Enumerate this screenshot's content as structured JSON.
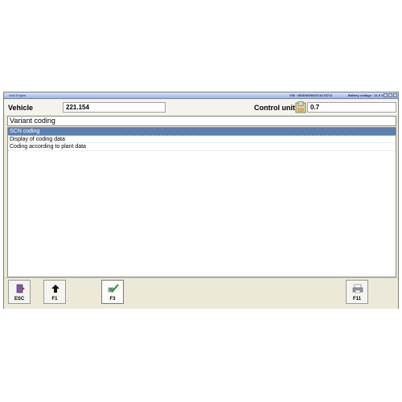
{
  "titlebar": {
    "app_title": "Vedi Engine",
    "vin_text": "VIN : WDDNG56X37A178711",
    "battery_text": "Battery voltage : 11.9 V"
  },
  "header": {
    "vehicle_label": "Vehicle",
    "vehicle_value": "221.154",
    "control_unit_label": "Control unit",
    "control_unit_value": "0.7"
  },
  "section": {
    "title": "Variant coding"
  },
  "list": {
    "items": [
      {
        "label": "SCN coding",
        "selected": true
      },
      {
        "label": "Display of coding data",
        "selected": false
      },
      {
        "label": "Coding according to plant data",
        "selected": false
      }
    ]
  },
  "toolbar": {
    "keys": [
      {
        "key": "ESC",
        "icon": "exit-door-icon"
      },
      {
        "key": "F1",
        "icon": "arrow-up-icon"
      },
      {
        "key": "F3",
        "icon": "checkmark-icon"
      },
      {
        "key": "F11",
        "icon": "printer-icon"
      }
    ]
  },
  "colors": {
    "selection": "#5a7fb0",
    "window_bg": "#ece9d8",
    "titlebar": "#9fb7e2"
  }
}
